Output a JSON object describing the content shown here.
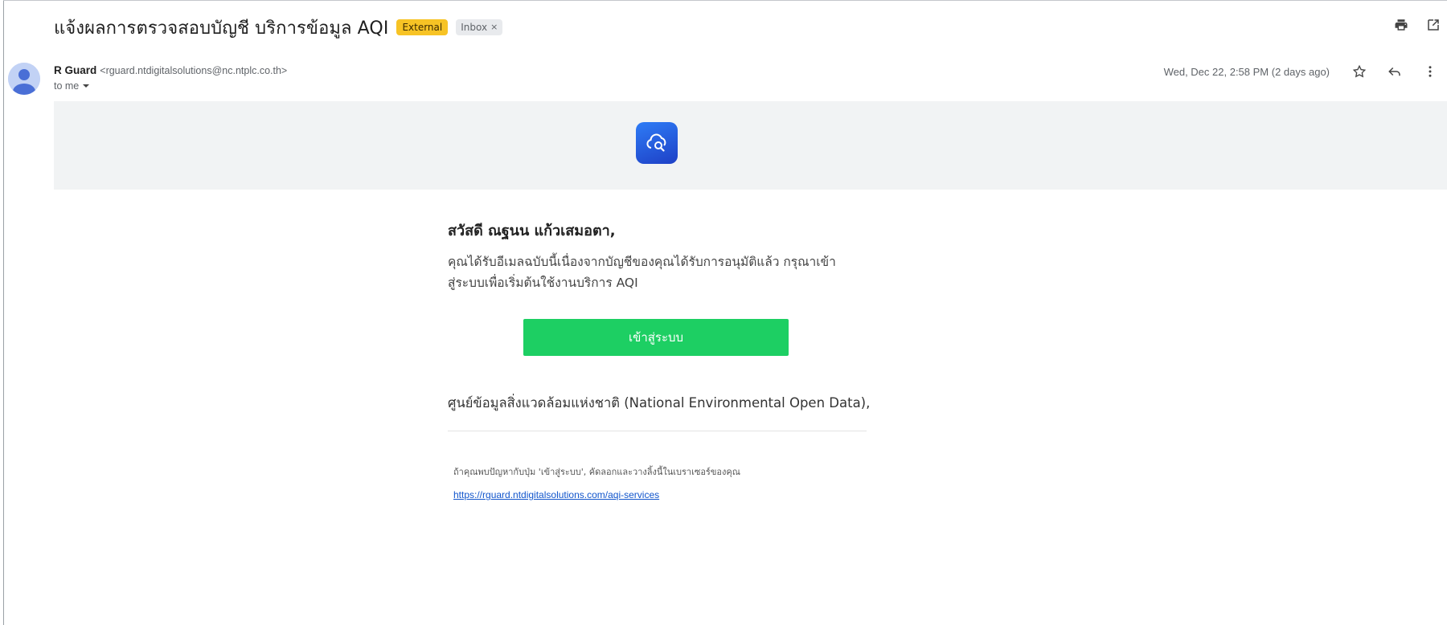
{
  "email": {
    "subject": "แจ้งผลการตรวจสอบบัญชี บริการข้อมูล AQI",
    "labels": {
      "external": "External",
      "inbox": "Inbox",
      "inbox_remove": "×"
    },
    "sender": {
      "name": "R Guard",
      "email": "<rguard.ntdigitalsolutions@nc.ntplc.co.th>",
      "to": "to me"
    },
    "date": "Wed, Dec 22, 2:58 PM (2 days ago)"
  },
  "body": {
    "greeting": "สวัสดี ณฐนน แก้วเสมอตา,",
    "message_line1": "คุณได้รับอีเมลฉบับนี้เนื่องจากบัญชีของคุณได้รับการอนุมัติแล้ว กรุณาเข้า",
    "message_line2": "สู่ระบบเพื่อเริ่มต้นใช้งานบริการ AQI",
    "cta_label": "เข้าสู่ระบบ",
    "signoff": "ศูนย์ข้อมูลสิ่งแวดล้อมแห่งชาติ (National Environmental Open Data),",
    "help_text": "ถ้าคุณพบปัญหากับปุ่ม 'เข้าสู่ระบบ', คัดลอกและวางลิ้งนี้ในเบราเซอร์ของคุณ",
    "help_link": "https://rguard.ntdigitalsolutions.com/aqi-services"
  },
  "icons": {
    "print": "print-icon",
    "open_new_window": "open-in-new-window-icon",
    "star": "star-icon",
    "reply": "reply-icon",
    "more": "more-vert-icon",
    "to_dropdown": "chevron-down-icon",
    "logo": "cloud-search-logo"
  },
  "colors": {
    "external_tag": "#f7c325",
    "cta_button": "#1dcf63",
    "logo_blue": "#2e6cf0",
    "link": "#1155cc"
  }
}
